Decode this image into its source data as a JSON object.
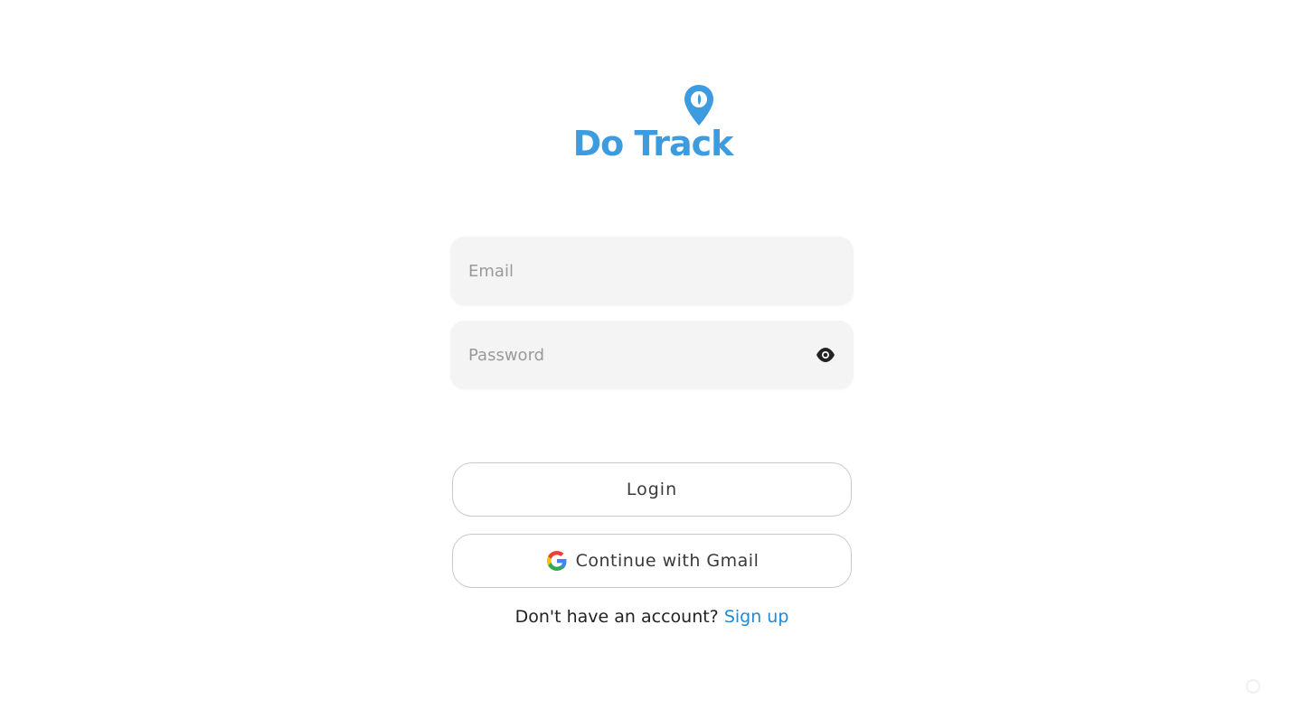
{
  "brand": {
    "name": "Do Track",
    "logo_icon": "map-pin-icon",
    "color": "#3d9be0"
  },
  "form": {
    "email": {
      "placeholder": "Email",
      "value": ""
    },
    "password": {
      "placeholder": "Password",
      "value": "",
      "toggle_icon": "eye-icon"
    },
    "login_label": "Login",
    "gmail_label": "Continue with Gmail",
    "gmail_icon": "google-icon"
  },
  "signup": {
    "prompt": "Don't have an account?",
    "link_label": "Sign up",
    "link_color": "#1e8ad8"
  },
  "watermark": {
    "icon": "watermark-icon"
  }
}
